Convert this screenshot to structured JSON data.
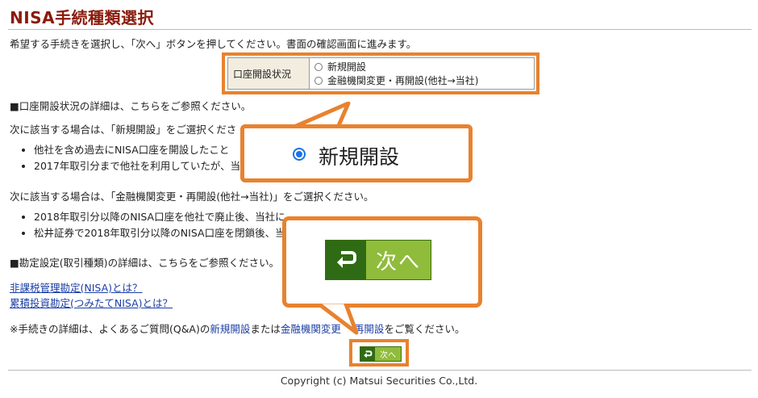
{
  "page_title": "NISA手続種類選択",
  "intro": "希望する手続きを選択し、「次へ」ボタンを押してください。書面の確認画面に進みます。",
  "account_status": {
    "label": "口座開設状況",
    "options": [
      "新規開設",
      "金融機関変更・再開設(他社→当社)"
    ]
  },
  "detail_note": "■口座開設状況の詳細は、こちらをご参照ください。",
  "case1": {
    "heading": "次に該当する場合は、「新規開設」をご選択ください。",
    "heading_visible": "次に該当する場合は、「新規開設」をご選択くださ",
    "bullets": [
      "他社を含め過去にNISA口座を開設したこと",
      "2017年取引分まで他社を利用していたが、当"
    ]
  },
  "case2": {
    "heading": "次に該当する場合は、「金融機関変更・再開設(他社→当社)」をご選択ください。",
    "bullets": [
      "2018年取引分以降のNISA口座を他社で廃止後、当社に",
      "松井証券で2018年取引分以降のNISA口座を閉鎖後、当"
    ]
  },
  "account_type_note": "■勘定設定(取引種類)の詳細は、こちらをご参照ください。",
  "links": [
    "非課税管理勘定(NISA)とは？",
    "累積投資勘定(つみたてNISA)とは？"
  ],
  "faq": {
    "prefix": "※手続きの詳細は、よくあるご質問(Q&A)の",
    "link1": "新規開設",
    "mid": "または",
    "link2": "金融機関変更",
    "link3": "再開設",
    "suffix": "をご覧ください。"
  },
  "callout_radio_label": "新規開設",
  "next_button_label": "次へ",
  "copyright": "Copyright (c) Matsui Securities Co.,Ltd.",
  "colors": {
    "highlight": "#e8822e",
    "title": "#8b1a0a",
    "button_dark": "#2f6b15",
    "button_light": "#8fbc3a",
    "radio": "#1a73e8",
    "link": "#1b3fa6"
  }
}
